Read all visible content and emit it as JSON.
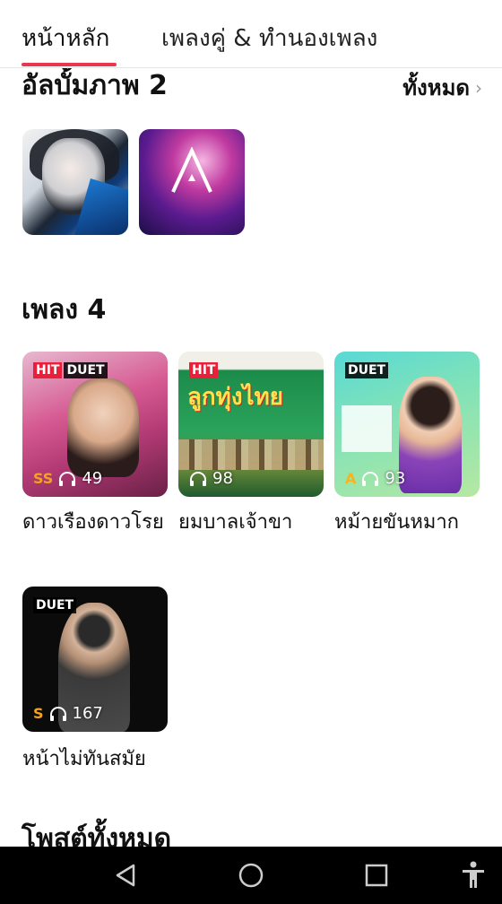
{
  "tabs": {
    "home": "หน้าหลัก",
    "duet": "เพลงคู่ & ทำนองเพลง",
    "active_color": "#e8384f"
  },
  "albums_section": {
    "title": "อัลบั้มภาพ 2",
    "see_all": "ทั้งหมด"
  },
  "songs_section": {
    "title": "เพลง 4",
    "items": [
      {
        "title": "ดาวเรืองดาวโรย",
        "badges": [
          "HIT",
          "DUET"
        ],
        "rank": "SS",
        "plays": "49"
      },
      {
        "title": "ยมบาลเจ้าขา",
        "badges": [
          "HIT"
        ],
        "rank": "",
        "plays": "98"
      },
      {
        "title": "หม้ายขันหมาก",
        "badges": [
          "DUET"
        ],
        "rank": "A",
        "plays": "93"
      },
      {
        "title": "หน้าไม่ทันสมัย",
        "badges": [
          "DUET"
        ],
        "rank": "S",
        "plays": "167"
      }
    ]
  },
  "posts_section": {
    "title": "โพสต์ทั้งหมด"
  },
  "navbar": {
    "icons": [
      "back-icon",
      "home-icon",
      "recent-apps-icon",
      "accessibility-icon"
    ]
  }
}
